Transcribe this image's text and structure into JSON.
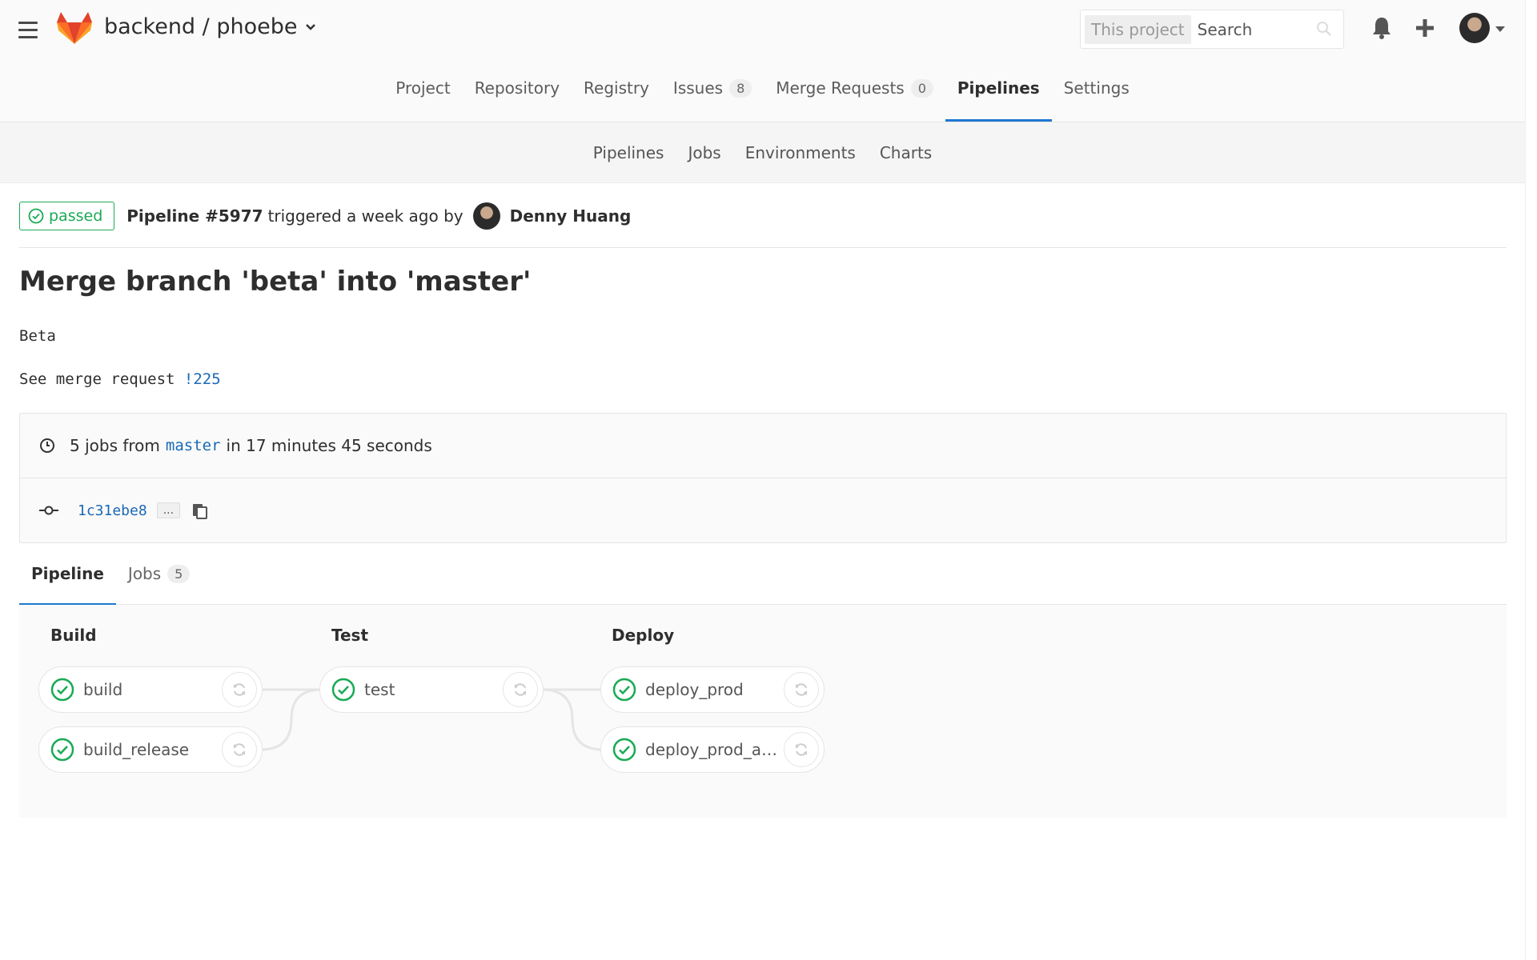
{
  "header": {
    "project_path": "backend / phoebe",
    "search_scope": "This project",
    "search_placeholder": "Search"
  },
  "nav": {
    "items": [
      {
        "label": "Project"
      },
      {
        "label": "Repository"
      },
      {
        "label": "Registry"
      },
      {
        "label": "Issues",
        "badge": "8"
      },
      {
        "label": "Merge Requests",
        "badge": "0"
      },
      {
        "label": "Pipelines",
        "active": true
      },
      {
        "label": "Settings"
      }
    ]
  },
  "subnav": {
    "items": [
      "Pipelines",
      "Jobs",
      "Environments",
      "Charts"
    ]
  },
  "pipeline": {
    "status": "passed",
    "id": "Pipeline #5977",
    "triggered_text": "triggered a week ago by",
    "author": "Denny Huang"
  },
  "commit": {
    "title": "Merge branch 'beta' into 'master'",
    "desc_line1": "Beta",
    "desc_line2_prefix": "See merge request",
    "mr_link": "!225"
  },
  "info": {
    "jobs_prefix": "5 jobs from",
    "branch": "master",
    "duration_text": "in 17 minutes 45 seconds",
    "sha": "1c31ebe8",
    "ellipsis": "..."
  },
  "tabs": {
    "pipeline_label": "Pipeline",
    "jobs_label": "Jobs",
    "jobs_count": "5"
  },
  "graph": {
    "stages": [
      {
        "title": "Build",
        "jobs": [
          "build",
          "build_release"
        ]
      },
      {
        "title": "Test",
        "jobs": [
          "test"
        ]
      },
      {
        "title": "Deploy",
        "jobs": [
          "deploy_prod",
          "deploy_prod_ad..."
        ]
      }
    ]
  },
  "colors": {
    "success": "#1aaa55",
    "accent": "#1f78d1",
    "link": "#1b69b6",
    "logo_orange": "#fc6d26",
    "logo_red": "#e24329"
  },
  "icons": [
    "hamburger-icon",
    "gitlab-logo",
    "search-icon",
    "bell-icon",
    "plus-icon",
    "clock-icon",
    "commit-icon",
    "clipboard-icon",
    "check-circle-icon",
    "retry-icon"
  ]
}
